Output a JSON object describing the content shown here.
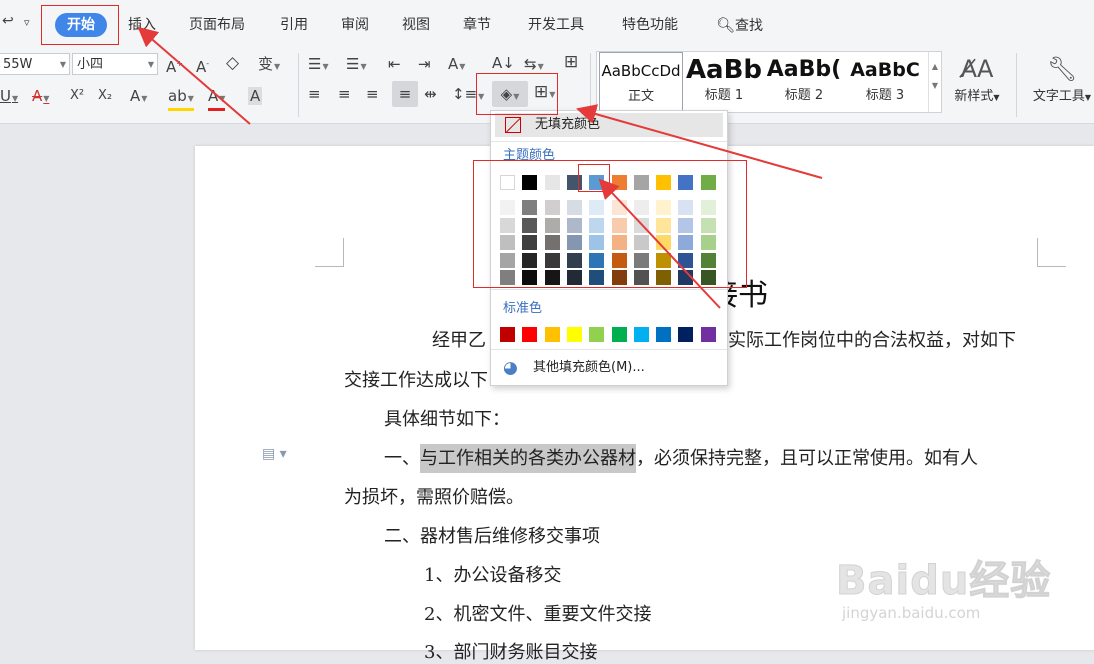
{
  "tabs": [
    {
      "label": "开始",
      "active": true
    },
    {
      "label": "插入"
    },
    {
      "label": "页面布局"
    },
    {
      "label": "引用"
    },
    {
      "label": "审阅"
    },
    {
      "label": "视图"
    },
    {
      "label": "章节"
    },
    {
      "label": "开发工具"
    },
    {
      "label": "特色功能"
    }
  ],
  "search_label": "查找",
  "font": {
    "name": "55W",
    "size": "小四"
  },
  "styles": [
    {
      "preview": "AaBbCcDd",
      "label": "正文"
    },
    {
      "preview": "AaBb",
      "label": "标题 1"
    },
    {
      "preview": "AaBb(",
      "label": "标题 2"
    },
    {
      "preview": "AaBbC",
      "label": "标题 3"
    }
  ],
  "new_style_label": "新样式",
  "text_tools_label": "文字工具",
  "shading_menu": {
    "no_fill": "无填充颜色",
    "theme_colors_title": "主题颜色",
    "theme_top": [
      "#ffffff",
      "#000000",
      "#e7e6e6",
      "#44546a",
      "#5b9bd5",
      "#ed7d31",
      "#a5a5a5",
      "#ffc000",
      "#4472c4",
      "#70ad47"
    ],
    "theme_shades": [
      [
        "#f2f2f2",
        "#7f7f7f",
        "#d0cece",
        "#d6dce4",
        "#deebf6",
        "#fbe5d5",
        "#ededed",
        "#fff2cc",
        "#d9e2f3",
        "#e2efd9"
      ],
      [
        "#d8d8d8",
        "#595959",
        "#aeabab",
        "#adb9ca",
        "#bdd7ee",
        "#f7cbac",
        "#dbdbdb",
        "#fee599",
        "#b4c6e7",
        "#c5e0b3"
      ],
      [
        "#bfbfbf",
        "#3f3f3f",
        "#757070",
        "#8496b0",
        "#9dc3e6",
        "#f4b183",
        "#c9c9c9",
        "#ffd965",
        "#8eaadb",
        "#a8d08d"
      ],
      [
        "#a5a5a5",
        "#262626",
        "#3a3838",
        "#323f4f",
        "#2e75b5",
        "#c55a11",
        "#7b7b7b",
        "#bf9000",
        "#2f5496",
        "#538135"
      ],
      [
        "#7f7f7f",
        "#0c0c0c",
        "#171616",
        "#222a35",
        "#1e4e79",
        "#833c0b",
        "#525252",
        "#7f6000",
        "#1f3864",
        "#375623"
      ]
    ],
    "standard_title": "标准色",
    "standard": [
      "#c00000",
      "#ff0000",
      "#ffc000",
      "#ffff00",
      "#92d050",
      "#00b050",
      "#00b0f0",
      "#0070c0",
      "#002060",
      "#7030a0"
    ],
    "more_colors": "其他填充颜色(M)..."
  },
  "document": {
    "title_partial": "接书",
    "lines": [
      {
        "text": "经甲乙",
        "tail": "实际工作岗位中的合法权益，对如下"
      },
      {
        "text": "交接工作达成以下"
      },
      {
        "text": "具体细节如下："
      },
      {
        "prefix": "一、",
        "selected": "与工作相关的各类办公器材",
        "rest": "，必须保持完整，且可以正常使用。如有人"
      },
      {
        "text": "为损坏，需照价赔偿。"
      },
      {
        "text": "二、器材售后维修移交事项"
      },
      {
        "text": "1、办公设备移交"
      },
      {
        "text": "2、机密文件、重要文件交接"
      },
      {
        "text": "3、部门财务账目交接"
      }
    ]
  },
  "watermark": {
    "brand": "Baidu经验",
    "url": "jingyan.baidu.com"
  }
}
